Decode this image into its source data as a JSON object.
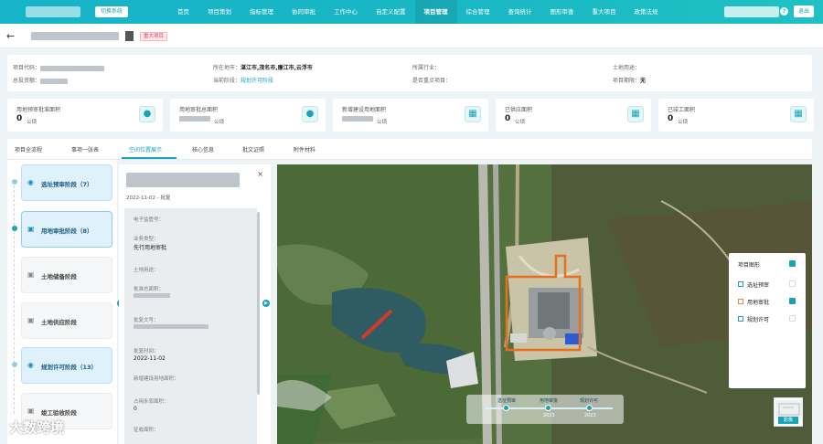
{
  "topbar": {
    "system_switch": "切换系统",
    "nav": [
      "首页",
      "项目策划",
      "指标管理",
      "协同审批",
      "工作中心",
      "自定义配置",
      "项目管理",
      "综合管理",
      "查询统计",
      "图形审查",
      "重大项目",
      "政策法规"
    ],
    "active_nav": 6,
    "logout": "退出",
    "help_icon": "help-icon"
  },
  "titlebar": {
    "tag": "重大项目",
    "back_icon": "arrow-left-icon",
    "doc_icon": "document-icon"
  },
  "info": {
    "project_code_label": "项目代码：",
    "investment_label": "总投资额：",
    "location_label": "所在地市：",
    "location_value": "湛江市,茂名市,廉江市,云浮市",
    "stage_label": "当前阶段：",
    "stage_value": "规划许可阶段",
    "industry_label": "所属行业：",
    "key_project_label": "是否重点项目：",
    "land_use_label": "土地用途：",
    "deadline_label": "项目期限：",
    "deadline_value": "无"
  },
  "stats": [
    {
      "label": "用地预审批准面积",
      "value": "0",
      "unit": "公顷",
      "icon": "person-icon"
    },
    {
      "label": "用地审批总面积",
      "value": "",
      "unit": "公顷",
      "icon": "person-icon"
    },
    {
      "label": "新增建设用地面积",
      "value": "",
      "unit": "公顷",
      "icon": "grid-icon"
    },
    {
      "label": "已供应面积",
      "value": "0",
      "unit": "公顷",
      "icon": "grid-icon"
    },
    {
      "label": "已竣工面积",
      "value": "0",
      "unit": "公顷",
      "icon": "grid-icon"
    }
  ],
  "tabs": [
    "项目全流程",
    "事项一张表",
    "空间位置展示",
    "核心信息",
    "批文证照",
    "附件材料"
  ],
  "active_tab": 2,
  "stages": [
    {
      "label": "选址预审阶段（7）",
      "icon": "location-pin-icon"
    },
    {
      "label": "用地审批阶段（8）",
      "icon": "document-icon"
    },
    {
      "label": "土地储备阶段",
      "icon": "document-icon"
    },
    {
      "label": "土地供应阶段",
      "icon": "document-icon"
    },
    {
      "label": "规划许可阶段（13）",
      "icon": "stamp-icon"
    },
    {
      "label": "竣工验收阶段",
      "icon": "document-icon"
    }
  ],
  "detail": {
    "date": "2022-11-02 - 批复",
    "fields": [
      {
        "label": "电子监管号：",
        "value": ""
      },
      {
        "label": "业务类型：",
        "value": "先行用地审批"
      },
      {
        "label": "土地用途：",
        "value": ""
      },
      {
        "label": "批准总面积：",
        "value": ""
      },
      {
        "label": "批复文号：",
        "value": ""
      },
      {
        "label": "批复时间：",
        "value": "2022-11-02"
      },
      {
        "label": "新增建设用地面积：",
        "value": ""
      },
      {
        "label": "占用永农面积：",
        "value": "0"
      },
      {
        "label": "征收面积：",
        "value": ""
      }
    ]
  },
  "legend": {
    "title": "项目图形",
    "items": [
      {
        "label": "选址预审",
        "color": "#1aa3b6",
        "checked": false
      },
      {
        "label": "用地审批",
        "color": "#f08a24",
        "checked": true
      },
      {
        "label": "规划许可",
        "color": "#1aa3b6",
        "checked": false
      }
    ]
  },
  "timeline": {
    "labels": [
      "选址预审",
      "用地审批",
      "规划许可"
    ],
    "years": [
      "2023",
      "2023"
    ]
  },
  "minimap_label": "影像",
  "watermark": "大数跨境"
}
